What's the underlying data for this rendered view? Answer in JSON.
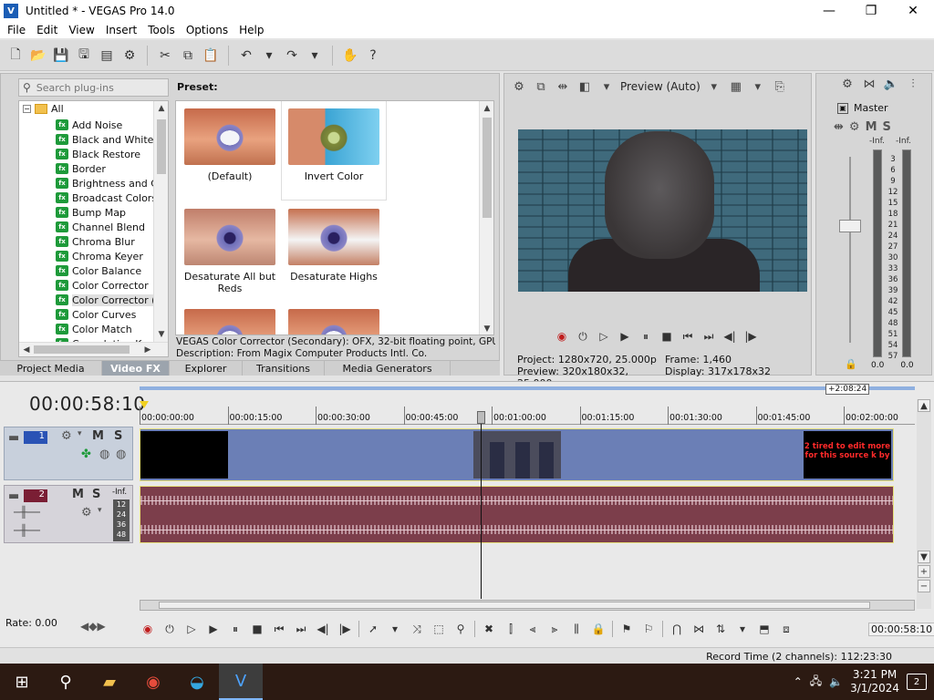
{
  "window": {
    "title": "Untitled * - VEGAS Pro 14.0",
    "minimize": "—",
    "maximize": "❐",
    "close": "✕"
  },
  "menu": [
    "File",
    "Edit",
    "View",
    "Insert",
    "Tools",
    "Options",
    "Help"
  ],
  "plugins": {
    "search_placeholder": "Search plug-ins",
    "root": "All",
    "items": [
      "Add Noise",
      "Black and White",
      "Black Restore",
      "Border",
      "Brightness and Co",
      "Broadcast Colors",
      "Bump Map",
      "Channel Blend",
      "Chroma Blur",
      "Chroma Keyer",
      "Color Balance",
      "Color Corrector",
      "Color Corrector (S",
      "Color Curves",
      "Color Match",
      "Convolution Kerne"
    ],
    "selected_index": 12
  },
  "presets": {
    "label": "Preset:",
    "items": [
      "(Default)",
      "Invert Color",
      "Desaturate All but Reds",
      "Desaturate Highs",
      "",
      ""
    ],
    "description_line1": "VEGAS Color Corrector (Secondary): OFX, 32-bit floating point, GPU Acc",
    "description_line2": "Description: From Magix Computer Products Intl. Co."
  },
  "dock_tabs": [
    "Project Media",
    "Video FX",
    "Explorer",
    "Transitions",
    "Media Generators"
  ],
  "dock_tabs_active": "Video FX",
  "preview": {
    "mode": "Preview (Auto)",
    "project_label": "Project:",
    "project_value": "1280x720, 25.000p",
    "preview_label": "Preview:",
    "preview_value": "320x180x32, 25.000p",
    "frame_label": "Frame:",
    "frame_value": "1,460",
    "display_label": "Display:",
    "display_value": "317x178x32"
  },
  "master": {
    "label": "Master",
    "inf_left": "-Inf.",
    "inf_right": "-Inf.",
    "scale": [
      "3",
      "6",
      "9",
      "12",
      "15",
      "18",
      "21",
      "24",
      "27",
      "30",
      "33",
      "36",
      "39",
      "42",
      "45",
      "48",
      "51",
      "54",
      "57"
    ],
    "value_left": "0.0",
    "value_right": "0.0"
  },
  "timeline": {
    "timecode": "00:00:58:10",
    "loop_length": "+2:08:24",
    "ruler": [
      "00:00:00:00",
      "00:00:15:00",
      "00:00:30:00",
      "00:00:45:00",
      "00:01:00:00",
      "00:01:15:00",
      "00:01:30:00",
      "00:01:45:00",
      "00:02:00:00"
    ],
    "video_track_number": "1",
    "audio_track_number": "2",
    "audio_inf": "-Inf.",
    "audio_scale": [
      "12",
      "24",
      "36",
      "48"
    ],
    "text_clip": "2 tired to edit more for this source k by",
    "rate": "Rate: 0.00",
    "bottom_time": "00:00:58:10"
  },
  "status": {
    "record_time": "Record Time (2 channels): 112:23:30"
  },
  "taskbar": {
    "time": "3:21 PM",
    "date": "3/1/2024",
    "notifications": "2"
  }
}
